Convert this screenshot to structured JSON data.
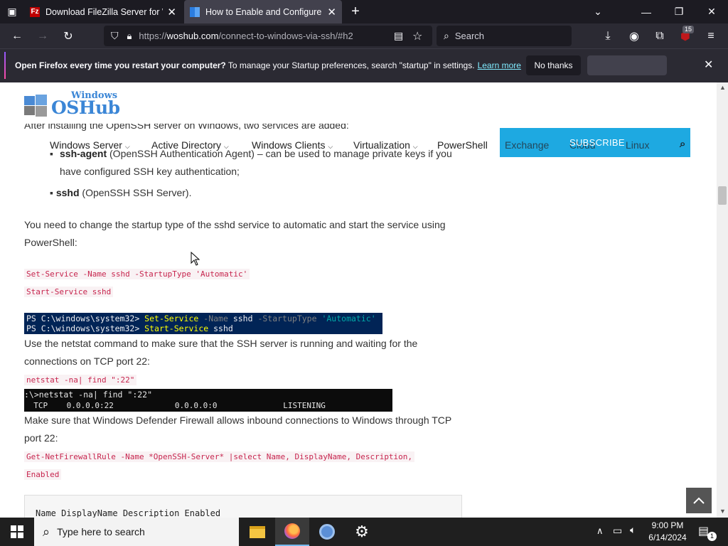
{
  "browser": {
    "tabs": [
      {
        "title": "Download FileZilla Server for Wi",
        "active": false
      },
      {
        "title": "How to Enable and Configure SS",
        "active": true
      }
    ],
    "url_prefix": "https://",
    "url_host": "woshub.com",
    "url_path": "/connect-to-windows-via-ssh/#h2",
    "search_placeholder": "Search",
    "extension_badge": "15"
  },
  "notification": {
    "bold_text": "Open Firefox every time you restart your computer?",
    "text": " To manage your Startup preferences, search \"startup\" in settings.",
    "link": "Learn more",
    "button": "No thanks"
  },
  "site": {
    "logo_line1": "Windows",
    "logo_line2": "OSHub",
    "nav": [
      "Windows Server",
      "Active Directory",
      "Windows Clients",
      "Virtualization",
      "PowerShell",
      "Exchange",
      "Cloud",
      "Linux"
    ],
    "subscribe": "SUBSCRIBE"
  },
  "article": {
    "intro": "After installing the OpenSSH server on Windows, two services are added:",
    "b1_bold": "ssh-agent",
    "b1_text": " (OpenSSH Authentication Agent) – can be used to manage private keys if you",
    "b1_text2": "have configured SSH key authentication;",
    "b2_bold": "sshd",
    "b2_text": " (OpenSSH SSH Server).",
    "p1_l1": "You need to change the startup type of the sshd service to automatic and start the service using",
    "p1_l2": "PowerShell:",
    "code1": "Set-Service -Name sshd -StartupType 'Automatic'",
    "code2": "Start-Service sshd",
    "ps_prompt": "PS C:\\windows\\system32> ",
    "ps_cmd1": "Set-Service",
    "ps_param1": " -Name",
    "ps_arg1": " sshd",
    "ps_param2": " -StartupType",
    "ps_arg2": " 'Automatic'",
    "ps_cmd2": "Start-Service",
    "ps_arg3": " sshd",
    "p2_l1": "Use the netstat command to make sure that the SSH server is running and waiting for the",
    "p2_l2": "connections on TCP port 22:",
    "code3": "netstat -na| find \":22\"",
    "cmd_line1": ":\\>netstat -na| find \":22\"",
    "cmd_line2": "  TCP    0.0.0.0:22             0.0.0.0:0              LISTENING",
    "p3_l1": "Make sure that Windows Defender Firewall allows inbound connections to Windows through TCP",
    "p3_l2": "port 22:",
    "code4a": "Get-NetFirewallRule -Name *OpenSSH-Server* |select Name, DisplayName, Description,",
    "code4b": "Enabled",
    "table_header": "Name DisplayName Description Enabled"
  },
  "taskbar": {
    "search_placeholder": "Type here to search",
    "time": "9:00 PM",
    "date": "6/14/2024",
    "notif_count": "1"
  }
}
